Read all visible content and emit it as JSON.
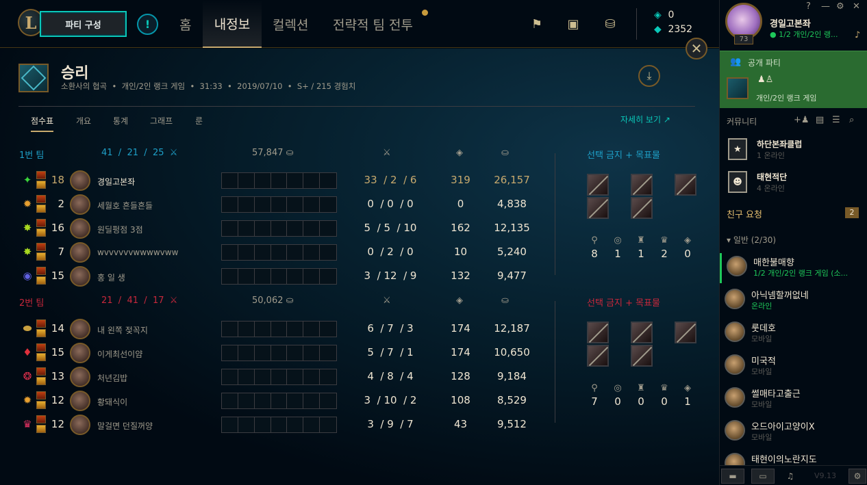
{
  "nav": {
    "party_button": "파티 구성",
    "alert_icon": "!",
    "tabs": [
      {
        "label": "홈"
      },
      {
        "label": "내정보"
      },
      {
        "label": "컬렉션"
      },
      {
        "label": "전략적 팀 전투"
      }
    ],
    "currency": {
      "rp": "0",
      "be": "2352"
    }
  },
  "match": {
    "result": "승리",
    "map": "소환사의 협곡",
    "queue": "개인/2인 랭크 게임",
    "duration": "31:33",
    "date": "2019/07/10",
    "grade": "S+ / 215 경험치",
    "sep": "•",
    "subtabs": [
      "점수표",
      "개요",
      "통계",
      "그래프",
      "룬"
    ],
    "detail_link": "자세히 보기 ↗"
  },
  "teams": [
    {
      "name": "1번 팀",
      "k": "41",
      "d": "21",
      "a": "25",
      "gold": "57,847",
      "color": "#1ea0c8",
      "bans_title": "선택 금지 + 목표물",
      "objectives": [
        "8",
        "1",
        "1",
        "2",
        "0"
      ],
      "players": [
        {
          "level": "18",
          "name": "경일고본좌",
          "k": "33",
          "d": "2",
          "a": "6",
          "cs": "319",
          "gold": "26,157",
          "me": true,
          "spell": "✦",
          "spell_color": "#3bd43b"
        },
        {
          "level": "2",
          "name": "세월호 흔들흔들",
          "k": "0",
          "d": "0",
          "a": "0",
          "cs": "0",
          "gold": "4,838",
          "spell": "✹",
          "spell_color": "#e8a030"
        },
        {
          "level": "16",
          "name": "원딜펑점 3점",
          "k": "5",
          "d": "5",
          "a": "10",
          "cs": "162",
          "gold": "12,135",
          "spell": "✸",
          "spell_color": "#a8d820"
        },
        {
          "level": "7",
          "name": "wvvvvvvwwwwvww",
          "k": "0",
          "d": "2",
          "a": "0",
          "cs": "10",
          "gold": "5,240",
          "spell": "✸",
          "spell_color": "#a8d820"
        },
        {
          "level": "15",
          "name": "홍 일 생",
          "k": "3",
          "d": "12",
          "a": "9",
          "cs": "132",
          "gold": "9,477",
          "spell": "◉",
          "spell_color": "#6060e0"
        }
      ]
    },
    {
      "name": "2번 팀",
      "k": "21",
      "d": "41",
      "a": "17",
      "gold": "50,062",
      "color": "#c8283c",
      "bans_title": "선택 금지 + 목표물",
      "objectives": [
        "7",
        "0",
        "0",
        "0",
        "1"
      ],
      "players": [
        {
          "level": "14",
          "name": "내 왼쪽 젖꼭지",
          "k": "6",
          "d": "7",
          "a": "3",
          "cs": "174",
          "gold": "12,187",
          "spell": "⬬",
          "spell_color": "#c8a040"
        },
        {
          "level": "15",
          "name": "이게최선이얌",
          "k": "5",
          "d": "7",
          "a": "1",
          "cs": "174",
          "gold": "10,650",
          "spell": "♦",
          "spell_color": "#e0303c"
        },
        {
          "level": "13",
          "name": "처년김밥",
          "k": "4",
          "d": "8",
          "a": "4",
          "cs": "128",
          "gold": "9,184",
          "spell": "❂",
          "spell_color": "#e0304c"
        },
        {
          "level": "12",
          "name": "황돼식이",
          "k": "3",
          "d": "10",
          "a": "2",
          "cs": "108",
          "gold": "8,529",
          "spell": "✹",
          "spell_color": "#e8a030"
        },
        {
          "level": "12",
          "name": "말걸면 던질꺼양",
          "k": "3",
          "d": "9",
          "a": "7",
          "cs": "43",
          "gold": "9,512",
          "spell": "♛",
          "spell_color": "#e03060"
        }
      ]
    }
  ],
  "side": {
    "profile_name": "경일고본좌",
    "profile_status": "1/2 개인/2인 랭...",
    "profile_level": "73",
    "party_label": "공개 파티",
    "party_queue": "개인/2인 랭크 게임",
    "community": "커뮤니티",
    "clubs": [
      {
        "name": "하단본좌클럽",
        "online": "1 온라인"
      },
      {
        "name": "태현적단",
        "online": "4 온라인"
      }
    ],
    "requests_label": "친구 요청",
    "requests_count": "2",
    "group_label": "일반 (2/30)",
    "friends": [
      {
        "name": "매한불매향",
        "status": "1/2 개인/2인 랭크 게임 (소...",
        "status_color": "#1ec85a"
      },
      {
        "name": "아닉넴할꺼없네",
        "status": "온라인",
        "status_color": "#1ec85a"
      },
      {
        "name": "룻데호",
        "status": "모바일",
        "status_color": "#5b5a56"
      },
      {
        "name": "미국적",
        "status": "모바일",
        "status_color": "#5b5a56"
      },
      {
        "name": "썰매타고출근",
        "status": "모바일",
        "status_color": "#5b5a56"
      },
      {
        "name": "오드아이고양이X",
        "status": "모바일",
        "status_color": "#5b5a56"
      },
      {
        "name": "태현이의노란지도",
        "status": "",
        "status_color": "#5b5a56"
      }
    ],
    "version": "V9.13"
  }
}
